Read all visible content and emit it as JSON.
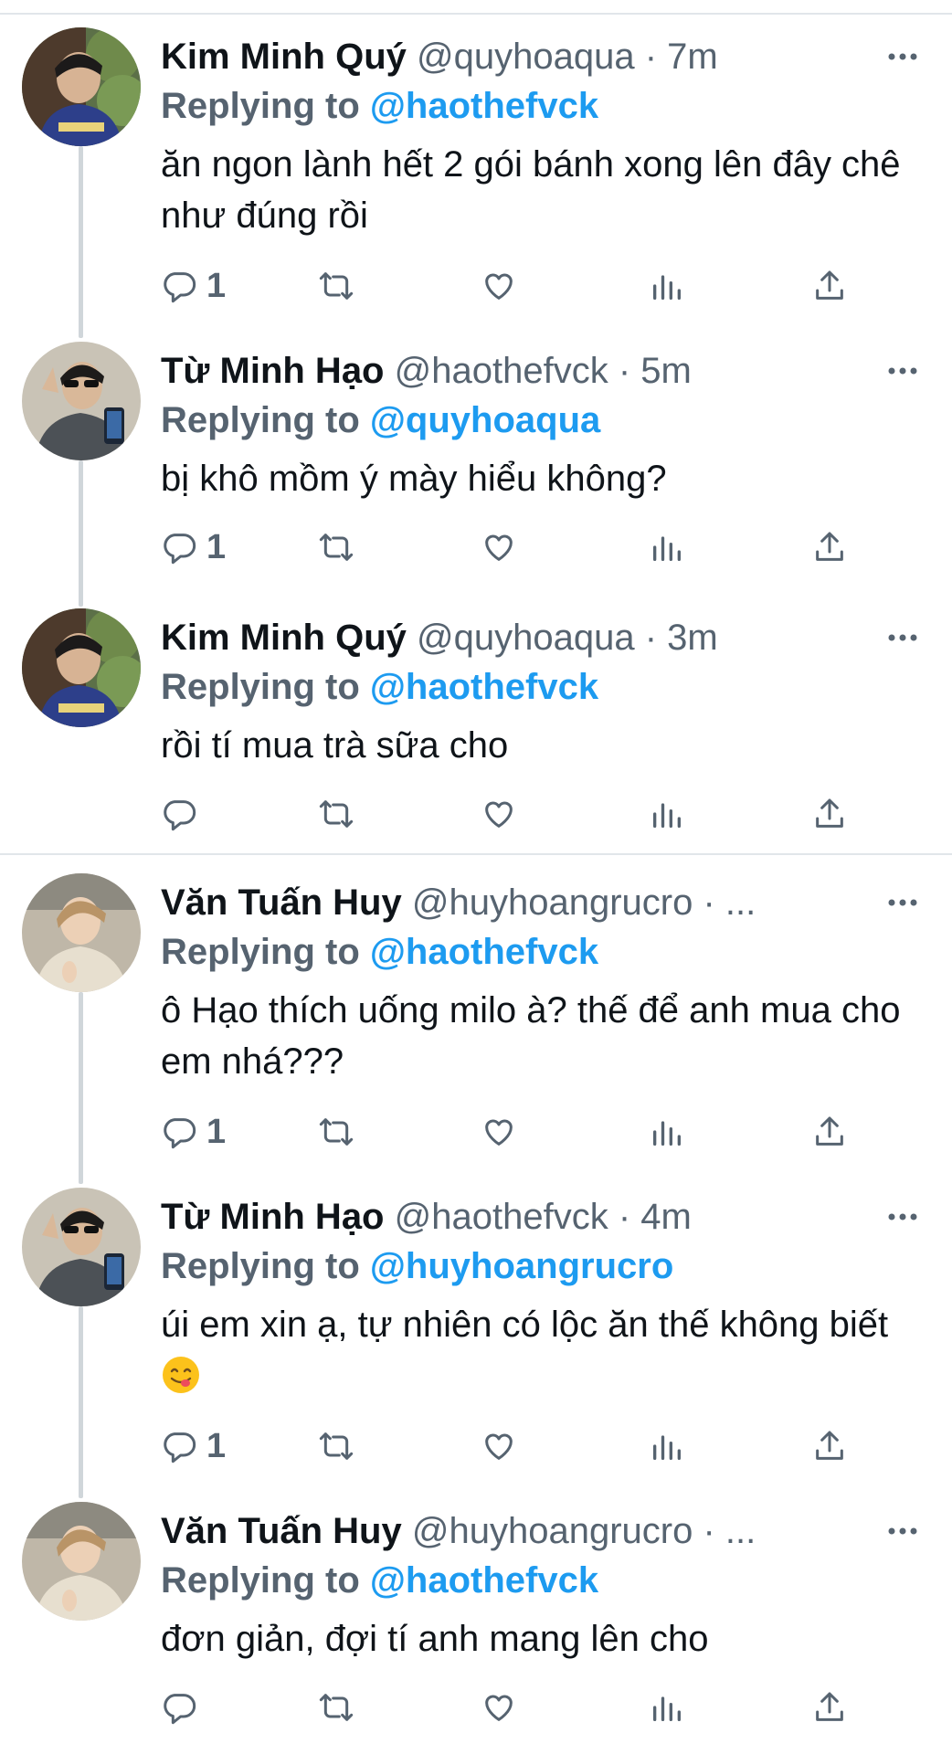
{
  "thread": [
    {
      "name": "Kim Minh Quý",
      "handle": "@quyhoaqua",
      "separator": "·",
      "time": "7m",
      "reply_label": "Replying to",
      "reply_to": "@haothefvck",
      "text": "ăn ngon lành hết 2 gói bánh xong lên đây chê như đúng rồi",
      "reply_count": "1"
    },
    {
      "name": "Từ Minh Hạo",
      "handle": "@haothefvck",
      "separator": "·",
      "time": "5m",
      "reply_label": "Replying to",
      "reply_to": "@quyhoaqua",
      "text": "bị khô mồm ý mày hiểu không?",
      "reply_count": "1"
    },
    {
      "name": "Kim Minh Quý",
      "handle": "@quyhoaqua",
      "separator": "·",
      "time": "3m",
      "reply_label": "Replying to",
      "reply_to": "@haothefvck",
      "text": "rồi tí mua trà sữa cho",
      "reply_count": ""
    },
    {
      "name": "Văn Tuấn Huy",
      "handle": "@huyhoangrucro",
      "separator": "·",
      "time": "...",
      "reply_label": "Replying to",
      "reply_to": "@haothefvck",
      "text": "ô Hạo thích uống milo à? thế để anh mua cho em nhá???",
      "reply_count": "1"
    },
    {
      "name": "Từ Minh Hạo",
      "handle": "@haothefvck",
      "separator": "·",
      "time": "4m",
      "reply_label": "Replying to",
      "reply_to": "@huyhoangrucro",
      "text": "úi em xin ạ, tự nhiên có lộc ăn thế không biết",
      "reply_count": "1"
    },
    {
      "name": "Văn Tuấn Huy",
      "handle": "@huyhoangrucro",
      "separator": "·",
      "time": "...",
      "reply_label": "Replying to",
      "reply_to": "@haothefvck",
      "text": "đơn giản, đợi tí anh mang lên cho",
      "reply_count": ""
    }
  ],
  "icons": {
    "reply": "reply-icon",
    "retweet": "retweet-icon",
    "like": "heart-icon",
    "views": "analytics-icon",
    "share": "share-icon",
    "more": "more-icon",
    "emoji": "yum-face-emoji"
  },
  "colors": {
    "link": "#1d9bf0",
    "secondary_text": "#566370",
    "primary_text": "#0f1419",
    "divider": "#e1e6ea"
  }
}
